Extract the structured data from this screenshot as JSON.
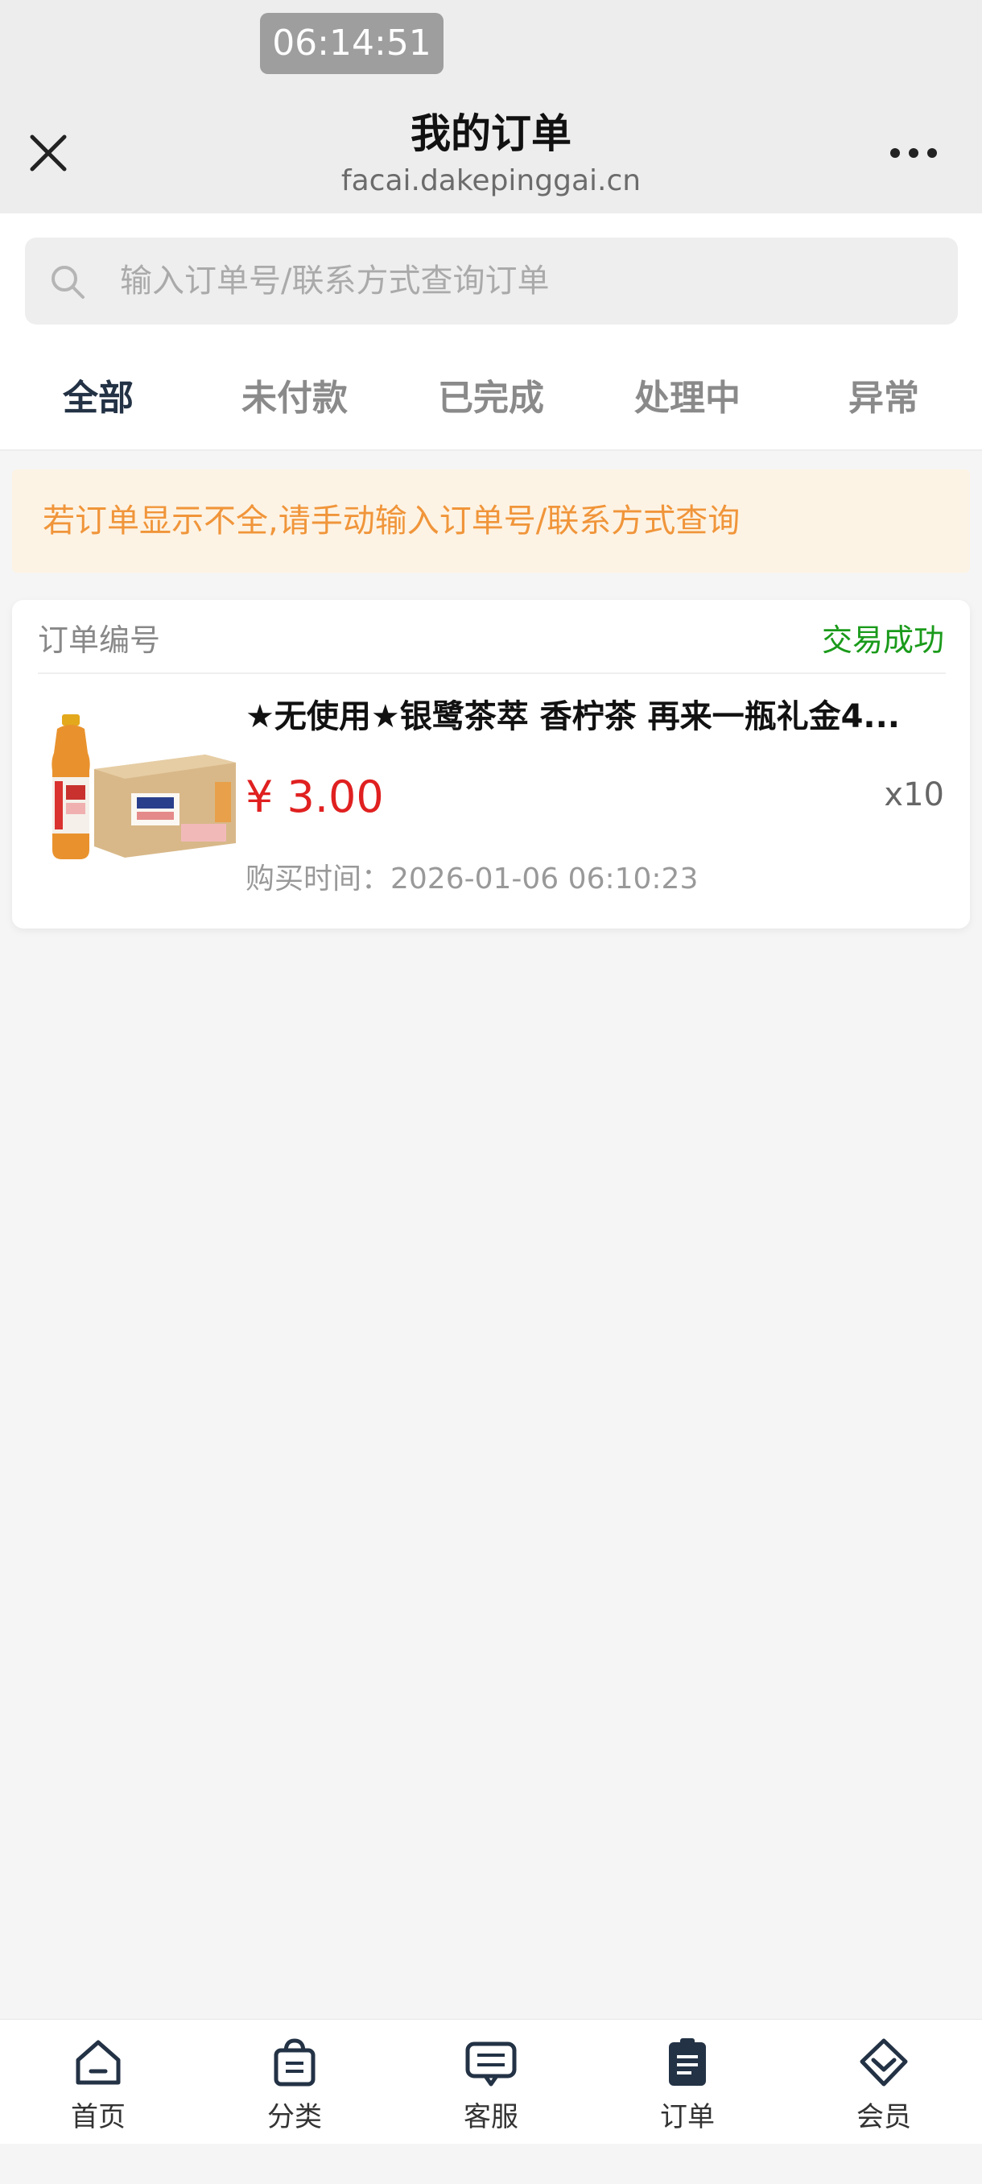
{
  "status_bar": {
    "time": "06:14:51"
  },
  "header": {
    "title": "我的订单",
    "domain": "facai.dakepinggai.cn",
    "close_icon": "close-icon",
    "more_icon": "more-dots-icon"
  },
  "search": {
    "placeholder": "输入订单号/联系方式查询订单",
    "icon": "search-icon"
  },
  "tabs": [
    {
      "label": "全部",
      "active": true
    },
    {
      "label": "未付款",
      "active": false
    },
    {
      "label": "已完成",
      "active": false
    },
    {
      "label": "处理中",
      "active": false
    },
    {
      "label": "异常",
      "active": false
    }
  ],
  "notice": {
    "text": "若订单显示不全,请手动输入订单号/联系方式查询"
  },
  "orders": [
    {
      "order_no_label": "订单编号",
      "status": "交易成功",
      "product_name": "★无使用★银鹭茶萃 香柠茶 再来一瓶礼金4...",
      "price": "¥ 3.00",
      "quantity": "x10",
      "purchase_time": "购买时间：2026-01-06 06:10:23"
    }
  ],
  "bottom_nav": [
    {
      "label": "首页",
      "icon": "home-icon"
    },
    {
      "label": "分类",
      "icon": "shopping-bag-icon"
    },
    {
      "label": "客服",
      "icon": "chat-icon"
    },
    {
      "label": "订单",
      "icon": "clipboard-icon"
    },
    {
      "label": "会员",
      "icon": "diamond-icon"
    }
  ],
  "colors": {
    "accent_tab": "#233245",
    "status_success": "#1a9a1a",
    "price_red": "#e02020",
    "notice_orange": "#f0953a",
    "notice_bg": "#fdf3e4"
  }
}
